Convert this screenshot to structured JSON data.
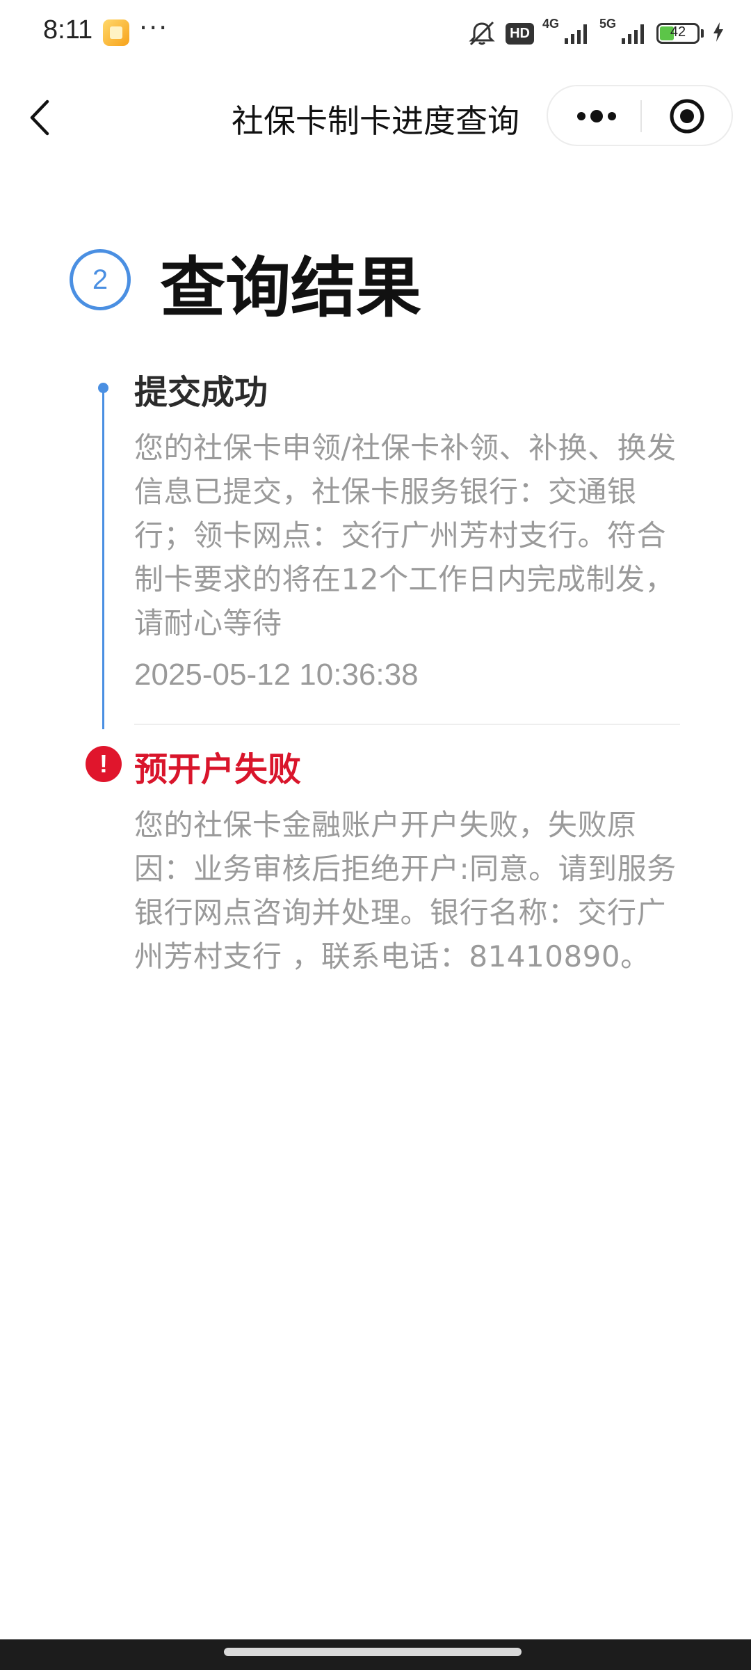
{
  "status_bar": {
    "time": "8:11",
    "more": "···",
    "hd_label": "HD",
    "net_4g": "4G",
    "net_5g": "5G",
    "battery_percent": "42",
    "battery_level": 0.42,
    "icons": [
      "notification-app-icon",
      "mute-icon",
      "signal-4g-icon",
      "signal-5g-icon",
      "battery-icon",
      "charging-icon"
    ]
  },
  "nav": {
    "title": "社保卡制卡进度查询",
    "icons": [
      "back-chevron-icon",
      "more-dots-icon",
      "close-target-icon"
    ]
  },
  "result": {
    "step_number": "2",
    "title": "查询结果"
  },
  "timeline": {
    "colors": {
      "line": "#4a8fe2",
      "error": "#e0152c",
      "fail_title": "#d9152b",
      "desc": "#9a9a9a"
    },
    "events": [
      {
        "title": "提交成功",
        "description": "您的社保卡申领/社保卡补领、补换、换发信息已提交，社保卡服务银行：交通银行；领卡网点：交行广州芳村支行。符合制卡要求的将在12个工作日内完成制发，请耐心等待",
        "time": "2025-05-12 10:36:38"
      },
      {
        "error_mark": "!",
        "title": "预开户失败",
        "description": "您的社保卡金融账户开户失败，失败原因：业务审核后拒绝开户:同意。请到服务银行网点咨询并处理。银行名称：交行广州芳村支行 ，联系电话：81410890。"
      }
    ]
  }
}
